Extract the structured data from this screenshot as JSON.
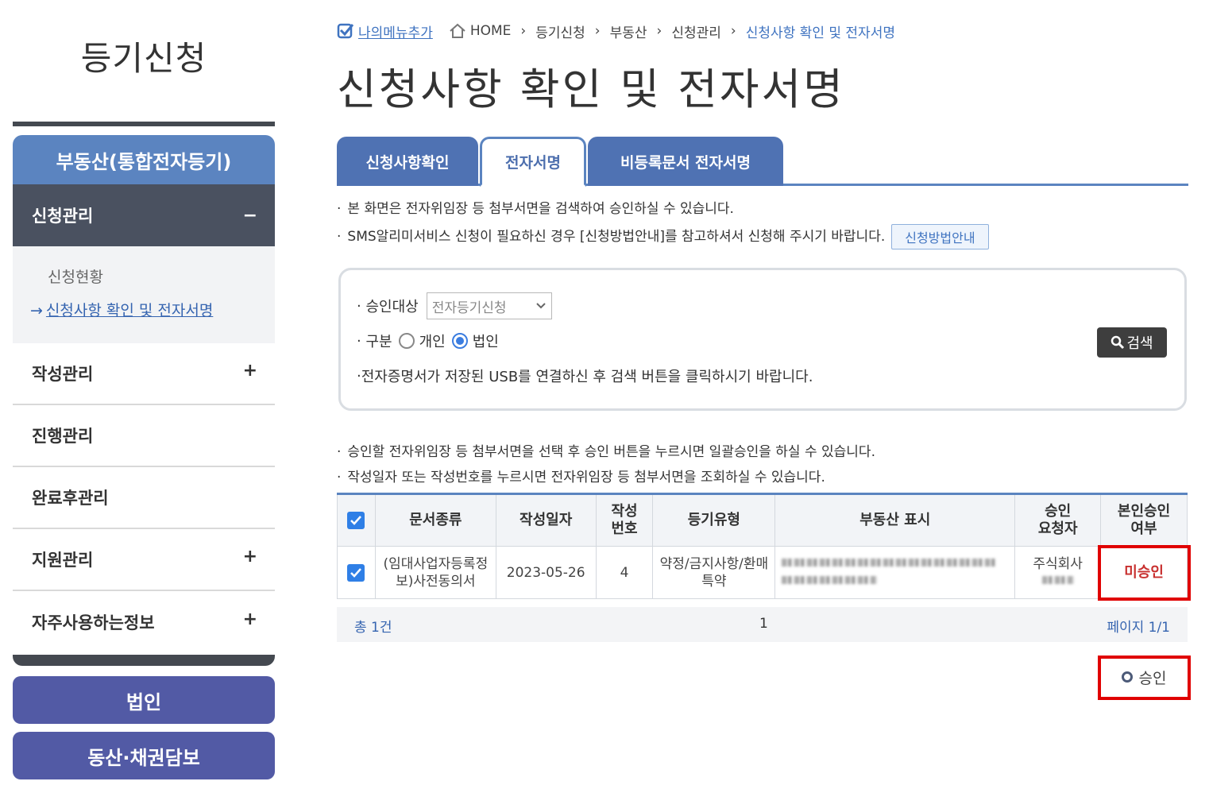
{
  "sidebar": {
    "title": "등기신청",
    "header": "부동산(통합전자등기)",
    "open_section": {
      "label": "신청관리",
      "sign": "−"
    },
    "sub_items": [
      "신청현황",
      "신청사항 확인 및 전자서명"
    ],
    "sub_arrow": "→",
    "items": [
      {
        "label": "작성관리",
        "sign": "+"
      },
      {
        "label": "진행관리",
        "sign": ""
      },
      {
        "label": "완료후관리",
        "sign": ""
      },
      {
        "label": "지원관리",
        "sign": "+"
      },
      {
        "label": "자주사용하는정보",
        "sign": "+"
      }
    ],
    "buttons": [
      "법인",
      "동산·채권담보"
    ]
  },
  "breadcrumb": {
    "my_menu": "나의메뉴추가",
    "items": [
      "HOME",
      "등기신청",
      "부동산",
      "신청관리",
      "신청사항 확인 및 전자서명"
    ],
    "separator": "›"
  },
  "page_title": "신청사항 확인 및 전자서명",
  "tabs": [
    "신청사항확인",
    "전자서명",
    "비등록문서 전자서명"
  ],
  "active_tab": 1,
  "notes_top": [
    "본 화면은 전자위임장 등 첨부서면을 검색하여 승인하실 수 있습니다.",
    "SMS알리미서비스 신청이 필요하신 경우 [신청방법안내]를 참고하셔서 신청해 주시기 바랍니다."
  ],
  "guide_button": "신청방법안내",
  "search": {
    "target_label": "승인대상",
    "target_value": "전자등기신청",
    "type_label": "구분",
    "radio_options": [
      "개인",
      "법인"
    ],
    "radio_selected": 1,
    "hint": "전자증명서가 저장된 USB를 연결하신 후 검색 버튼을 클릭하시기 바랍니다.",
    "search_button": "검색"
  },
  "notes_mid": [
    "승인할 전자위임장 등 첨부서면을 선택 후 승인 버튼을 누르시면 일괄승인을 하실 수 있습니다.",
    "작성일자 또는 작성번호를 누르시면 전자위임장 등 첨부서면을 조회하실 수 있습니다."
  ],
  "table": {
    "headers": [
      "문서종류",
      "작성일자",
      "작성\n번호",
      "등기유형",
      "부동산 표시",
      "승인\n요청자",
      "본인승인\n여부"
    ],
    "rows": [
      {
        "doc_type": "(임대사업자등록정보)사전동의서",
        "date": "2023-05-26",
        "number": "4",
        "reg_type": "약정/금지사항/환매특약",
        "requester": "주식회사",
        "status": "미승인"
      }
    ]
  },
  "footer": {
    "total": "총 1건",
    "page_num": "1",
    "page_info": "페이지 1/1"
  },
  "approve_button": "승인",
  "colors": {
    "accent": "#5b84c0",
    "sidebar_button": "#525aa5",
    "highlight": "#e00000",
    "status_red": "#c8302f"
  }
}
